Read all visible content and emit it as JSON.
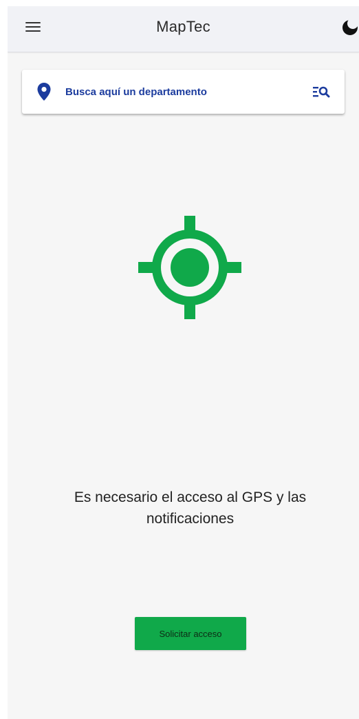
{
  "appbar": {
    "title": "MapTec",
    "menu_icon": "hamburger-menu-icon",
    "theme_icon": "dark-mode-moon-icon"
  },
  "search": {
    "placeholder": "Busca aquí un departamento",
    "value": "",
    "leading_icon": "location-pin-icon",
    "trailing_icon": "list-search-icon"
  },
  "main": {
    "gps_icon": "gps-target-icon",
    "message": "Es necesario el acceso al GPS y las notificaciones",
    "button_label": "Solicitar acceso"
  },
  "colors": {
    "accent_green": "#10a94a",
    "search_blue": "#1c3c9e",
    "background": "#f6f6f6",
    "appbar": "#f1f2f6"
  }
}
